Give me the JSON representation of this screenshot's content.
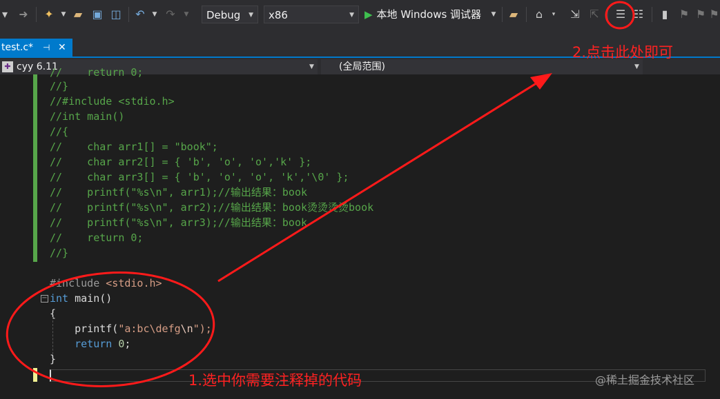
{
  "toolbar": {
    "config": "Debug",
    "platform": "x86",
    "run_label": "本地 Windows 调试器"
  },
  "tab": {
    "filename": "test.c*",
    "pin_glyph": "⊣",
    "close_glyph": "✕"
  },
  "navbar": {
    "project": "cyy 6.11",
    "scope": "(全局范围)"
  },
  "code": {
    "l0": "//    return 0;",
    "l1": "//}",
    "l2": "//#include <stdio.h>",
    "l3": "//int main()",
    "l4": "//{",
    "l5": "//    char arr1[] = \"book\";",
    "l6": "//    char arr2[] = { 'b', 'o', 'o','k' };",
    "l7": "//    char arr3[] = { 'b', 'o', 'o', 'k','\\0' };",
    "l8": "//    printf(\"%s\\n\", arr1);//输出结果：book",
    "l9": "//    printf(\"%s\\n\", arr2);//输出结果：book烫烫烫烫book",
    "l10": "//    printf(\"%s\\n\", arr3);//输出结果：book",
    "l11": "//    return 0;",
    "l12": "//}",
    "l14_pp": "#include ",
    "l14_hdr": "<stdio.h>",
    "l15_kw": "int",
    "l15_rest": " main()",
    "l16": "{",
    "l17_fn": "    printf(",
    "l17_str": "\"a:bc\\defg",
    "l17_esc": "\\n",
    "l17_end": "\");",
    "l18_kw": "    return ",
    "l18_num": "0",
    "l18_end": ";",
    "l19": "}"
  },
  "annotations": {
    "step2": "2.点击此处即可",
    "step1": "1.选中你需要注释掉的代码"
  },
  "watermark": "@稀土掘金技术社区",
  "colors": {
    "accent": "#007acc",
    "annotation": "#ff2222",
    "comment": "#57a64a",
    "keyword": "#569cd6"
  }
}
